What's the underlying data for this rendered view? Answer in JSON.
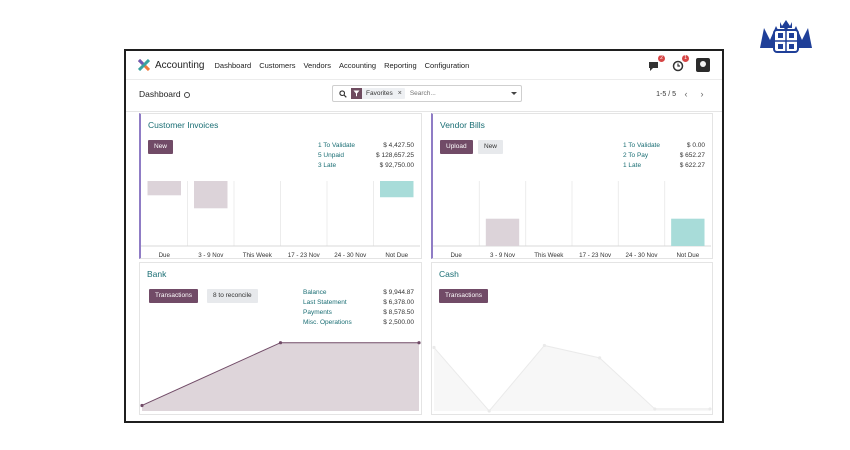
{
  "app": {
    "name": "Accounting",
    "menu": [
      "Dashboard",
      "Customers",
      "Vendors",
      "Accounting",
      "Reporting",
      "Configuration"
    ],
    "icons": {
      "app": "accounting-logo-icon",
      "messages": "chat-icon",
      "activities": "clock-icon"
    },
    "message_count": "2",
    "activity_count": "1"
  },
  "control": {
    "title": "Dashboard",
    "facet": "Favorites",
    "search_placeholder": "Search...",
    "pager": "1-5 / 5"
  },
  "customer_invoices": {
    "title": "Customer Invoices",
    "new_label": "New",
    "stats": [
      {
        "label": "1 To Validate",
        "value": "$ 4,427.50"
      },
      {
        "label": "5 Unpaid",
        "value": "$ 128,657.25"
      },
      {
        "label": "3 Late",
        "value": "$ 92,750.00"
      }
    ]
  },
  "vendor_bills": {
    "title": "Vendor Bills",
    "upload_label": "Upload",
    "new_label": "New",
    "stats": [
      {
        "label": "1 To Validate",
        "value": "$ 0.00"
      },
      {
        "label": "2 To Pay",
        "value": "$ 652.27"
      },
      {
        "label": "1 Late",
        "value": "$ 622.27"
      }
    ]
  },
  "bank": {
    "title": "Bank",
    "transactions_label": "Transactions",
    "reconcile_label": "8 to reconcile",
    "stats": [
      {
        "label": "Balance",
        "value": "$ 9,944.87"
      },
      {
        "label": "Last Statement",
        "value": "$ 6,378.00"
      },
      {
        "label": "Payments",
        "value": "$ 8,578.50"
      },
      {
        "label": "Misc. Operations",
        "value": "$ 2,500.00"
      }
    ]
  },
  "cash": {
    "title": "Cash",
    "transactions_label": "Transactions"
  },
  "colors": {
    "brand": "#714b67",
    "teal": "#1a6e74",
    "bar_past": "#dcd3d9",
    "bar_future": "#a8dcd9",
    "accent_border": "#8f7cc5"
  },
  "chart_data": [
    {
      "type": "bar",
      "panel": "customer_invoices",
      "categories": [
        "Due",
        "3 - 9 Nov",
        "This Week",
        "17 - 23 Nov",
        "24 - 30 Nov",
        "Not Due"
      ],
      "values": [
        0.22,
        0.42,
        0,
        0,
        0,
        0.25
      ],
      "stacked_from_top": [
        true,
        true,
        false,
        false,
        false,
        true
      ],
      "colors": [
        "#dcd3d9",
        "#dcd3d9",
        "#dcd3d9",
        "#dcd3d9",
        "#dcd3d9",
        "#a8dcd9"
      ],
      "grid": true
    },
    {
      "type": "bar",
      "panel": "vendor_bills",
      "categories": [
        "Due",
        "3 - 9 Nov",
        "This Week",
        "17 - 23 Nov",
        "24 - 30 Nov",
        "Not Due"
      ],
      "values": [
        0,
        0.42,
        0,
        0,
        0,
        0.42
      ],
      "colors": [
        "#dcd3d9",
        "#dcd3d9",
        "#dcd3d9",
        "#dcd3d9",
        "#dcd3d9",
        "#a8dcd9"
      ],
      "grid": true
    },
    {
      "type": "area",
      "panel": "bank",
      "values": [
        0.08,
        0.99,
        0.99
      ],
      "color": "#714b67",
      "fill": "#ded5da"
    },
    {
      "type": "line",
      "panel": "cash",
      "values": [
        0.92,
        0.0,
        0.95,
        0.77,
        0.03,
        0.03
      ],
      "color": "#eaeaea",
      "fill": "#f7f7f7"
    }
  ]
}
